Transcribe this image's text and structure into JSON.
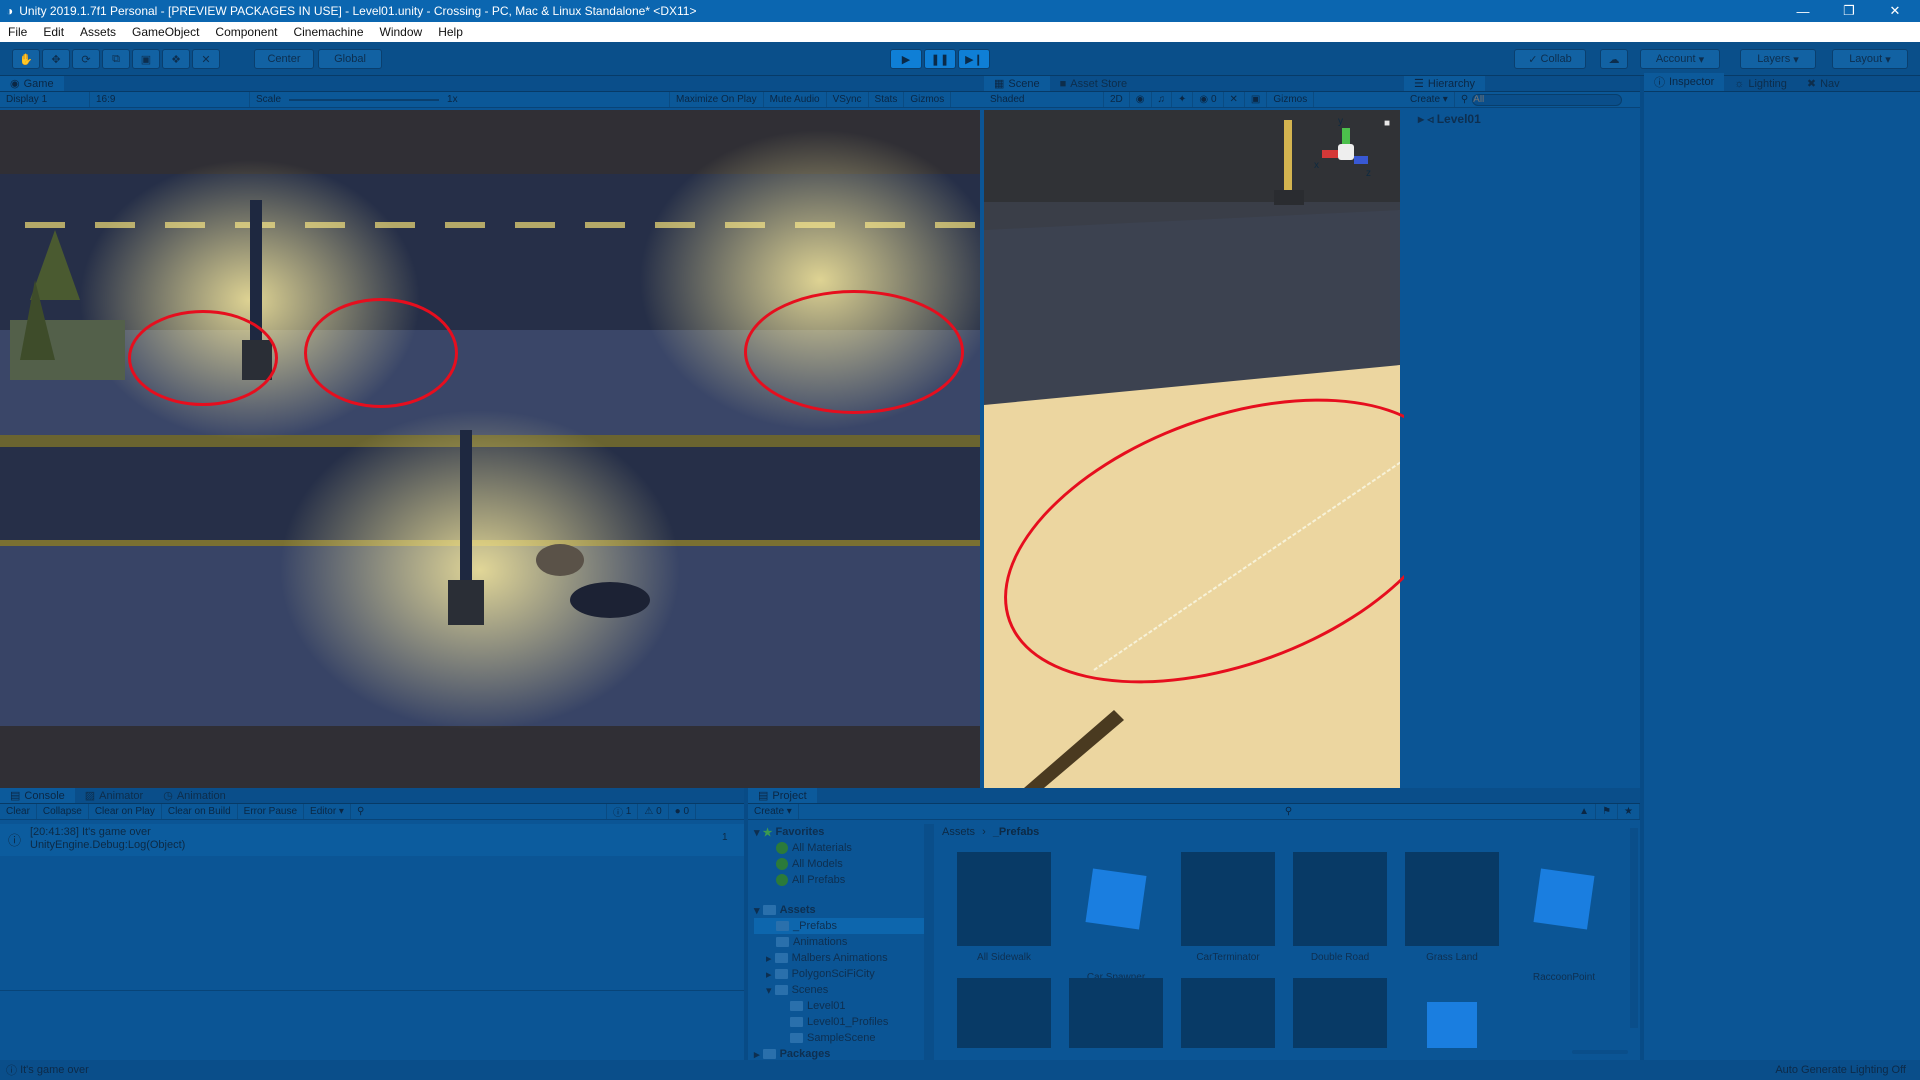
{
  "window": {
    "title": "Unity 2019.1.7f1 Personal - [PREVIEW PACKAGES IN USE] - Level01.unity - Crossing - PC, Mac & Linux Standalone* <DX11>",
    "minimize": "—",
    "restore": "❐",
    "close": "✕"
  },
  "menu": [
    "File",
    "Edit",
    "Assets",
    "GameObject",
    "Component",
    "Cinemachine",
    "Window",
    "Help"
  ],
  "toolbar": {
    "center": "Center",
    "global": "Global",
    "collab": "Collab",
    "account": "Account",
    "layers": "Layers",
    "layout": "Layout"
  },
  "game": {
    "tab": "Game",
    "display": "Display 1",
    "aspect": "16:9",
    "scale_label": "Scale",
    "scale_value": "1x",
    "maximize": "Maximize On Play",
    "mute": "Mute Audio",
    "vsync": "VSync",
    "stats": "Stats",
    "gizmos": "Gizmos"
  },
  "scene": {
    "tab": "Scene",
    "asset_store": "Asset Store",
    "shaded": "Shaded",
    "mode2d": "2D",
    "fx_count": "0",
    "gizmos": "Gizmos",
    "axis_y": "y",
    "axis_x": "x",
    "axis_z": "z"
  },
  "hierarchy": {
    "tab": "Hierarchy",
    "create": "Create",
    "search_placeholder": "All",
    "root": "Level01"
  },
  "inspector": {
    "tab": "Inspector",
    "lighting": "Lighting",
    "nav": "Nav"
  },
  "console": {
    "tab": "Console",
    "animator": "Animator",
    "animation": "Animation",
    "clear": "Clear",
    "collapse": "Collapse",
    "clear_on_play": "Clear on Play",
    "clear_on_build": "Clear on Build",
    "error_pause": "Error Pause",
    "editor": "Editor",
    "log_count": "1",
    "warn_count": "0",
    "err_count": "0",
    "entry_line1": "[20:41:38] It's game over",
    "entry_line2": "UnityEngine.Debug:Log(Object)",
    "entry_count": "1"
  },
  "project": {
    "tab": "Project",
    "create": "Create",
    "favorites": "Favorites",
    "fav_items": [
      "All Materials",
      "All Models",
      "All Prefabs"
    ],
    "assets": "Assets",
    "folders": [
      "_Prefabs",
      "Animations",
      "Malbers Animations",
      "PolygonSciFiCity",
      "Scenes"
    ],
    "scene_items": [
      "Level01",
      "Level01_Profiles",
      "SampleScene"
    ],
    "packages": "Packages",
    "breadcrumb_root": "Assets",
    "breadcrumb_sep": "›",
    "breadcrumb_current": "_Prefabs",
    "asset_items": [
      "All Sidewalk",
      "Car Spawner",
      "CarTerminator",
      "Double Road",
      "Grass Land",
      "RaccoonPoint"
    ]
  },
  "status": {
    "message": "It's game over",
    "right": "Auto Generate Lighting Off"
  },
  "colors": {
    "annotation": "#e60e1e",
    "editor_bg": "#084b86",
    "play_active": "#0f7fd6"
  }
}
